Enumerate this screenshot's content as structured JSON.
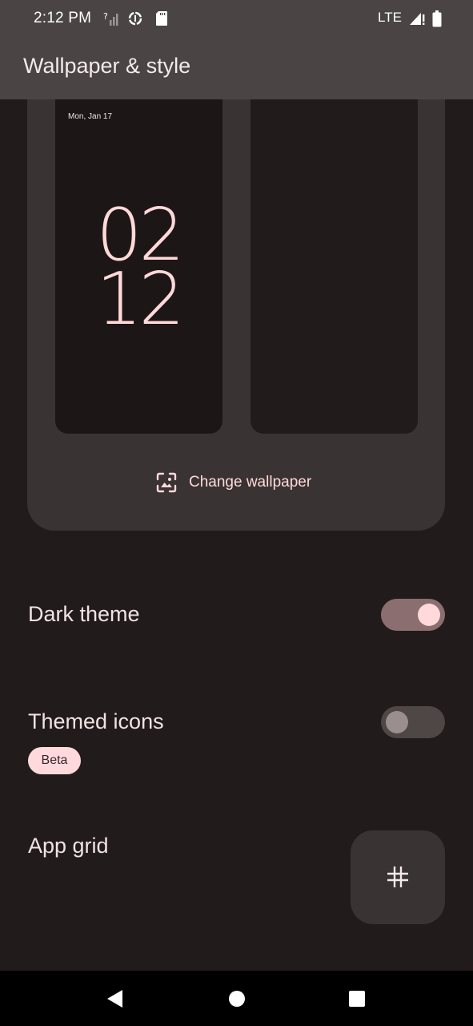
{
  "status_bar": {
    "time": "2:12 PM",
    "network": "LTE",
    "icons": [
      "signal-unknown-icon",
      "data-saver-icon",
      "sd-card-icon",
      "signal-full-icon",
      "battery-icon"
    ]
  },
  "app_bar": {
    "title": "Wallpaper & style"
  },
  "preview": {
    "lock_date": "Mon, Jan 17",
    "clock_hour": "02",
    "clock_minute": "12",
    "change_wallpaper_label": "Change wallpaper"
  },
  "settings": {
    "dark_theme": {
      "label": "Dark theme",
      "enabled": true
    },
    "themed_icons": {
      "label": "Themed icons",
      "badge": "Beta",
      "enabled": false
    },
    "app_grid": {
      "label": "App grid",
      "icon": "grid-icon"
    }
  },
  "nav_bar": {
    "buttons": [
      "back-icon",
      "home-icon",
      "recents-icon"
    ]
  },
  "colors": {
    "background": "#221b1b",
    "top_bar": "#4a4444",
    "card": "#3a3333",
    "accent": "#ffd9dc",
    "switch_track_on": "#8a6e70",
    "switch_track_off": "#4f4646"
  }
}
